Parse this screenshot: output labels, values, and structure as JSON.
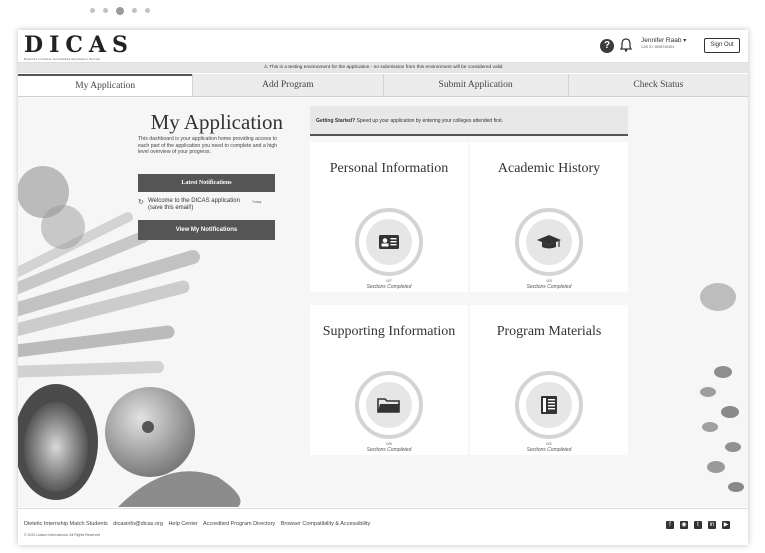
{
  "carousel": {
    "count": 5,
    "active_index": 2
  },
  "header": {
    "logo": "DICAS",
    "logo_sub": "Dietetics Inclusive Centralized Application Service",
    "help_icon": "question-circle-icon",
    "bell_icon": "bell-icon",
    "user_name": "Jennifer Raab",
    "user_id": "CAS ID: 5598745454",
    "sign_out": "Sign Out"
  },
  "banner": {
    "text": "⚠ This is a testing environment for the application - no submission from this environment will be considered valid"
  },
  "tabs": [
    "My Application",
    "Add Program",
    "Submit Application",
    "Check Status"
  ],
  "left_panel": {
    "title": "My Application",
    "description": "This dashboard is your application home providing access to each part of the application you need to complete and a high level overview of your progress.",
    "latest_notifications": "Latest Notifications",
    "notification": {
      "icon": "refresh-icon",
      "text": "Welcome to the DICAS application (save this email!)",
      "date": "Today"
    },
    "view_notifications": "View My Notifications"
  },
  "getting_started": {
    "bold": "Getting Started?",
    "text": " Speed up your application by entering your colleges attended first."
  },
  "cards": [
    {
      "title": "Personal Information",
      "icon": "id-card-icon",
      "count": "0/7",
      "label": "Sections Completed"
    },
    {
      "title": "Academic History",
      "icon": "graduation-cap-icon",
      "count": "0/3",
      "label": "Sections Completed"
    },
    {
      "title": "Supporting Information",
      "icon": "folder-icon",
      "count": "0/5",
      "label": "Sections Completed"
    },
    {
      "title": "Program Materials",
      "icon": "book-icon",
      "count": "0/2",
      "label": "Sections Completed"
    }
  ],
  "footer": {
    "links": [
      "Dietetic Internship Match Students",
      "dicasinfo@dicas.org",
      "Help Center",
      "Accredited Program Directory",
      "Browser Compatibility & Accessibility"
    ],
    "copyright": "© 2022 Liaison International. All Rights Reserved",
    "social": [
      "facebook-icon",
      "instagram-icon",
      "twitter-icon",
      "linkedin-icon",
      "youtube-icon"
    ]
  }
}
